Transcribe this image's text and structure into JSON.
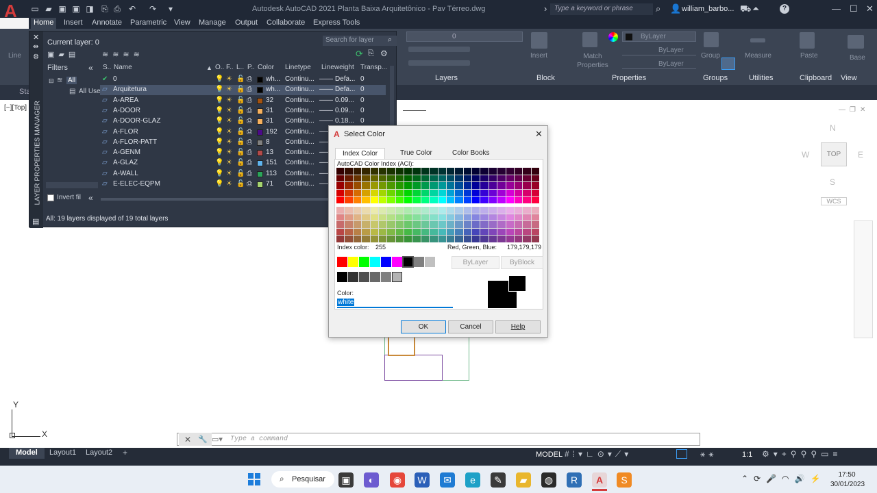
{
  "titlebar": {
    "logo": "A",
    "title": "Autodesk AutoCAD 2021   Planta Baixa Arquitetônico - Pav Térreo.dwg",
    "search_placeholder": "Type a keyword or phrase",
    "user": "william_barbo...",
    "help": "?"
  },
  "ribbon": {
    "tabs": [
      "Home",
      "Insert",
      "Annotate",
      "Parametric",
      "View",
      "Manage",
      "Output",
      "Collaborate",
      "Express Tools"
    ],
    "panels": [
      "Layers",
      "Block",
      "Properties",
      "Groups",
      "Utilities",
      "Clipboard",
      "View"
    ],
    "layer_combo": "0",
    "bylayer_color": "ByLayer",
    "bylayer_lineweight": "ByLayer",
    "bylayer_linetype": "ByLayer",
    "insert": "Insert",
    "match_properties": "Match Properties",
    "group": "Group",
    "measure": "Measure",
    "paste": "Paste",
    "base": "Base",
    "line": "Line",
    "start_tab": "Sta"
  },
  "viewport_label": "[−][Top]",
  "layer_manager": {
    "vertical_title": "LAYER PROPERTIES MANAGER",
    "current_layer": "Current layer: 0",
    "search_placeholder": "Search for layer",
    "filters_label": "Filters",
    "tree_all": "All",
    "tree_used": "All Use",
    "invert_filter": "Invert fil",
    "status": "All: 19 layers displayed of 19 total layers",
    "columns": [
      "S..",
      "Name",
      "O..",
      "F..",
      "L..",
      "P..",
      "Color",
      "Linetype",
      "Lineweight",
      "Transp..."
    ],
    "rows": [
      {
        "name": "0",
        "color_name": "wh...",
        "swatch": "#000000",
        "linetype": "Continu...",
        "lineweight": "Defa...",
        "transparency": "0",
        "current": true
      },
      {
        "name": "Arquitetura",
        "color_name": "wh...",
        "swatch": "#000000",
        "linetype": "Continu...",
        "lineweight": "Defa...",
        "transparency": "0",
        "selected": true
      },
      {
        "name": "A-AREA",
        "color_name": "32",
        "swatch": "#a4520f",
        "linetype": "Continu...",
        "lineweight": "0.09...",
        "transparency": "0"
      },
      {
        "name": "A-DOOR",
        "color_name": "31",
        "swatch": "#f7b15e",
        "linetype": "Continu...",
        "lineweight": "0.09...",
        "transparency": "0"
      },
      {
        "name": "A-DOOR-GLAZ",
        "color_name": "31",
        "swatch": "#f7b15e",
        "linetype": "Continu...",
        "lineweight": "0.18...",
        "transparency": "0"
      },
      {
        "name": "A-FLOR",
        "color_name": "192",
        "swatch": "#4b0a8a",
        "linetype": "Continu...",
        "lineweight": "Defa...",
        "transparency": "0"
      },
      {
        "name": "A-FLOR-PATT",
        "color_name": "8",
        "swatch": "#808080",
        "linetype": "Continu...",
        "lineweight": "Defa...",
        "transparency": "0"
      },
      {
        "name": "A-GENM",
        "color_name": "13",
        "swatch": "#b34a4a",
        "linetype": "Continu...",
        "lineweight": "Defa...",
        "transparency": "0"
      },
      {
        "name": "A-GLAZ",
        "color_name": "151",
        "swatch": "#5fb4ef",
        "linetype": "Continu...",
        "lineweight": "Defa...",
        "transparency": "0"
      },
      {
        "name": "A-WALL",
        "color_name": "113",
        "swatch": "#2aa55a",
        "linetype": "Continu...",
        "lineweight": "Defa...",
        "transparency": "0"
      },
      {
        "name": "E-ELEC-EQPM",
        "color_name": "71",
        "swatch": "#a5d46f",
        "linetype": "Continu...",
        "lineweight": "Defa...",
        "transparency": "0"
      }
    ]
  },
  "dialog": {
    "title": "Select Color",
    "tabs": [
      "Index Color",
      "True Color",
      "Color Books"
    ],
    "aci_label": "AutoCAD Color Index (ACI):",
    "index_color_label": "Index color:",
    "index_color_value": "255",
    "rgb_label": "Red, Green, Blue:",
    "rgb_value": "179,179,179",
    "bylayer": "ByLayer",
    "byblock": "ByBlock",
    "color_label": "Color:",
    "color_value": "white",
    "ok": "OK",
    "cancel": "Cancel",
    "help": "Help"
  },
  "viewcube": {
    "top": "TOP",
    "n": "N",
    "s": "S",
    "e": "E",
    "w": "W",
    "wcs": "WCS"
  },
  "ucs": {
    "x": "X",
    "y": "Y"
  },
  "command_placeholder": "Type a command",
  "status_tabs": [
    "Model",
    "Layout1",
    "Layout2"
  ],
  "status_right": {
    "model": "MODEL",
    "scale": "1:1"
  },
  "taskbar": {
    "search": "Pesquisar",
    "time": "17:50",
    "date": "30/01/2023"
  },
  "colors": {
    "accent": "#0078d7",
    "autocad_red": "#d43c3c"
  }
}
